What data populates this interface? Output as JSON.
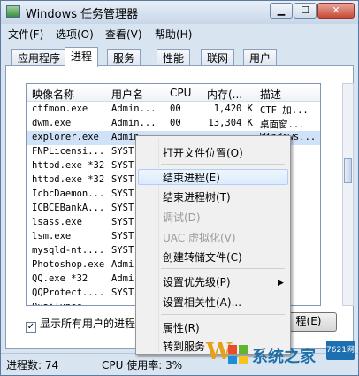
{
  "window": {
    "title": "Windows 任务管理器"
  },
  "titlebar": {
    "minimize": "▁",
    "maximize": "☐",
    "close": "✕"
  },
  "menu": [
    "文件(F)",
    "选项(O)",
    "查看(V)",
    "帮助(H)"
  ],
  "tabs": [
    "应用程序",
    "进程",
    "服务",
    "性能",
    "联网",
    "用户"
  ],
  "active_tab": "进程",
  "columns": {
    "name": "映像名称",
    "user": "用户名",
    "cpu": "CPU",
    "mem": "内存(...",
    "desc": "描述"
  },
  "processes": [
    {
      "name": "ctfmon.exe",
      "user": "Admin...",
      "cpu": "00",
      "mem": "1,420 K",
      "desc": "CTF 加..."
    },
    {
      "name": "dwm.exe",
      "user": "Admin...",
      "cpu": "00",
      "mem": "13,304 K",
      "desc": "桌面窗..."
    },
    {
      "name": "explorer.exe",
      "user": "Admin",
      "cpu": "",
      "mem": "",
      "desc": "Windows..."
    },
    {
      "name": "FNPLicensi...",
      "user": "SYST",
      "cpu": "",
      "mem": "",
      "desc": ""
    },
    {
      "name": "httpd.exe *32",
      "user": "SYST",
      "cpu": "",
      "mem": "",
      "desc": ""
    },
    {
      "name": "httpd.exe *32",
      "user": "SYST",
      "cpu": "",
      "mem": "",
      "desc": ""
    },
    {
      "name": "IcbcDaemon...",
      "user": "SYST",
      "cpu": "",
      "mem": "",
      "desc": ""
    },
    {
      "name": "ICBCEBankA...",
      "user": "SYST",
      "cpu": "",
      "mem": "",
      "desc": ""
    },
    {
      "name": "lsass.exe",
      "user": "SYST",
      "cpu": "",
      "mem": "",
      "desc": ""
    },
    {
      "name": "lsm.exe",
      "user": "SYST",
      "cpu": "",
      "mem": "",
      "desc": ""
    },
    {
      "name": "mysqld-nt....",
      "user": "SYST",
      "cpu": "",
      "mem": "",
      "desc": ""
    },
    {
      "name": "Photoshop.exe",
      "user": "Admi",
      "cpu": "",
      "mem": "",
      "desc": ""
    },
    {
      "name": "QQ.exe *32",
      "user": "Admi",
      "cpu": "",
      "mem": "",
      "desc": ""
    },
    {
      "name": "QQProtect....",
      "user": "SYST",
      "cpu": "",
      "mem": "",
      "desc": ""
    },
    {
      "name": "QuaiTunes",
      "user": "",
      "cpu": "",
      "mem": "",
      "desc": ""
    }
  ],
  "selected_row": "explorer.exe",
  "show_all_users": "显示所有用户的进程",
  "end_process_button": "程(E)",
  "context_menu": {
    "open_location": "打开文件位置(O)",
    "end_process": "结束进程(E)",
    "end_process_tree": "结束进程树(T)",
    "debug": "调试(D)",
    "uac_virtualization": "UAC 虚拟化(V)",
    "create_dump": "创建转储文件(C)",
    "set_priority": "设置优先级(P)",
    "set_affinity": "设置相关性(A)...",
    "properties": "属性(R)",
    "go_to_service": "转到服务"
  },
  "status": {
    "process_count": "进程数: 74",
    "cpu_usage": "CPU 使用率: 3%"
  },
  "watermark": {
    "letter": "W",
    "text": "系统之家",
    "badge": "7621网"
  },
  "colors": {
    "selection": "#cfe2f7",
    "window_frame": "#d9e4f1",
    "menu_hover": "#dcebfc"
  },
  "icons": {
    "app": "task-manager-icon",
    "submenu": "submenu-arrow-icon"
  }
}
